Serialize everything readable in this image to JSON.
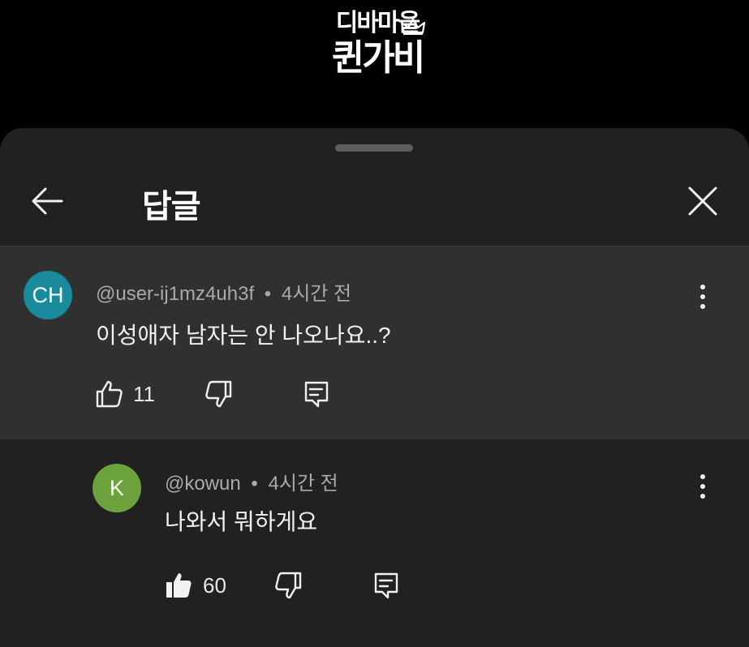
{
  "logo": {
    "line1": "디바마을",
    "line2": "퀸가비"
  },
  "header": {
    "title": "답글"
  },
  "comments": [
    {
      "avatar_text": "CH",
      "avatar_color": "#1a8a9d",
      "author": "@user-ij1mz4uh3f",
      "separator": "•",
      "time": "4시간 전",
      "text": "이성애자 남자는 안 나오나요..?",
      "like_count": "11",
      "liked": false
    },
    {
      "avatar_text": "K",
      "avatar_color": "#6ba23b",
      "author": "@kowun",
      "separator": "•",
      "time": "4시간 전",
      "text": "나와서 뭐하게요",
      "like_count": "60",
      "liked": true
    }
  ],
  "colors": {
    "background": "#000000",
    "sheet": "#212121",
    "highlight": "#303030"
  },
  "icons": [
    "back-arrow-icon",
    "close-icon",
    "thumbs-up-icon",
    "thumbs-down-icon",
    "reply-icon",
    "more-vert-icon",
    "crown-icon"
  ]
}
